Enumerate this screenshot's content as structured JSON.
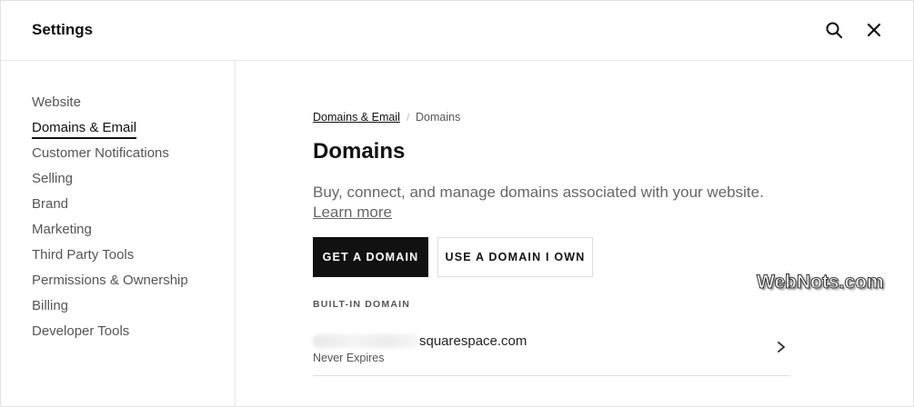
{
  "header": {
    "title": "Settings",
    "search_icon": "search-icon",
    "close_icon": "close-icon"
  },
  "sidebar": {
    "items": [
      {
        "label": "Website",
        "active": false
      },
      {
        "label": "Domains & Email",
        "active": true
      },
      {
        "label": "Customer Notifications",
        "active": false
      },
      {
        "label": "Selling",
        "active": false
      },
      {
        "label": "Brand",
        "active": false
      },
      {
        "label": "Marketing",
        "active": false
      },
      {
        "label": "Third Party Tools",
        "active": false
      },
      {
        "label": "Permissions & Ownership",
        "active": false
      },
      {
        "label": "Billing",
        "active": false
      },
      {
        "label": "Developer Tools",
        "active": false
      }
    ]
  },
  "breadcrumb": {
    "parent": "Domains & Email",
    "separator": "/",
    "current": "Domains"
  },
  "main": {
    "title": "Domains",
    "description": "Buy, connect, and manage domains associated with your website.",
    "learn_more": "Learn more",
    "get_domain_button": "GET A DOMAIN",
    "use_domain_button": "USE A DOMAIN I OWN",
    "section_label": "BUILT-IN DOMAIN",
    "domain": {
      "name": "squarespace.com",
      "status": "Never Expires",
      "chevron_icon": "chevron-right-icon"
    }
  },
  "watermark": "WebNots.com",
  "colors": {
    "primary_button": "#111111",
    "text": "#1a1a1a",
    "muted_text": "#555555",
    "border": "#e5e5e5"
  }
}
